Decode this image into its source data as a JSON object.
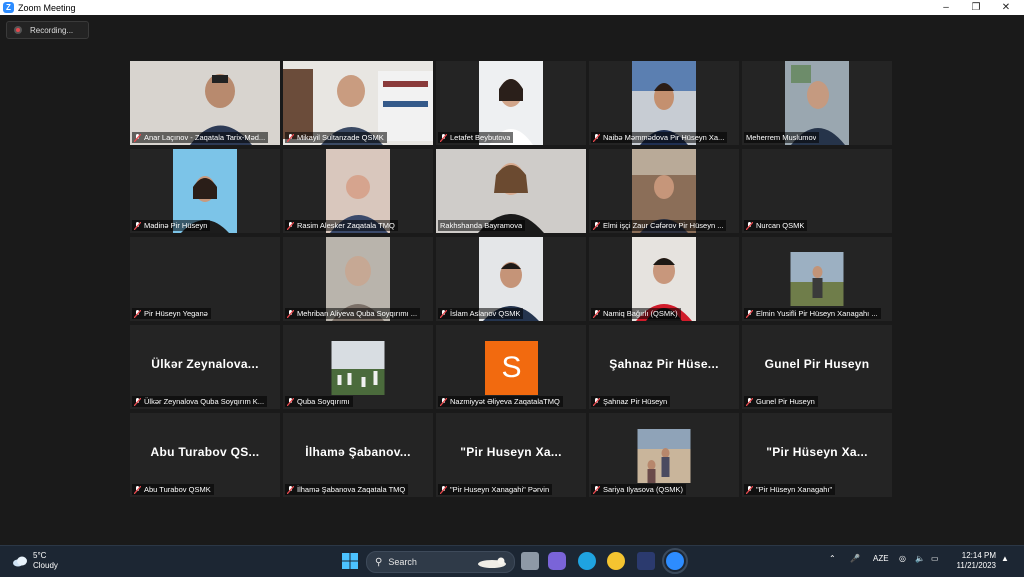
{
  "window": {
    "title": "Zoom Meeting",
    "logo_letter": "Z"
  },
  "recording": {
    "label": "Recording..."
  },
  "tiles": [
    {
      "name": "Anar Laçınov - Zaqatala Tarix-Məd...",
      "muted": true
    },
    {
      "name": "Mikayil Sultanzade QSMK",
      "muted": true
    },
    {
      "name": "Letafet Beybutova",
      "muted": true
    },
    {
      "name": "Naibə Məmmədova Pir Hüseyn Xa...",
      "muted": true
    },
    {
      "name": "Meherrem Muslumov",
      "muted": false
    },
    {
      "name": "Madinə Pir Hüseyn",
      "muted": true
    },
    {
      "name": "Rasim Alesker Zaqatala TMQ",
      "muted": true
    },
    {
      "name": "Rakhshanda Bayramova",
      "muted": false,
      "active": true
    },
    {
      "name": "Elmi işçi Zaur Cəfərov Pir Hüseyn ...",
      "muted": true
    },
    {
      "name": "Nurcan QSMK",
      "muted": true
    },
    {
      "name": "Pir Hüseyn Yeganə",
      "muted": true
    },
    {
      "name": "Mehriban Aliyeva Quba Soyqırımı ...",
      "muted": true
    },
    {
      "name": "İslam Aslanov QSMK",
      "muted": true
    },
    {
      "name": "Namiq Bağırlı (QSMK)",
      "muted": true
    },
    {
      "name": "Elmin Yusifli Pir Hüseyn Xanagahı ...",
      "muted": true
    },
    {
      "name": "Ülkər Zeynalova Quba Soyqırım K...",
      "muted": true,
      "display": "Ülkər Zeynalova..."
    },
    {
      "name": "Quba Soyqırımı",
      "muted": true
    },
    {
      "name": "Nazmiyyət Əliyeva ZaqatalaTMQ",
      "muted": true,
      "avatar_letter": "S"
    },
    {
      "name": "Şahnaz Pir Hüseyn",
      "muted": true,
      "display": "Şahnaz Pir Hüse..."
    },
    {
      "name": "Gunel Pir Huseyn",
      "muted": true,
      "display": "Gunel Pir Huseyn"
    },
    {
      "name": "Abu Turabov QSMK",
      "muted": true,
      "display": "Abu Turabov QS..."
    },
    {
      "name": "İlhamə Şabanova Zaqatala TMQ",
      "muted": true,
      "display": "İlhamə Şabanov..."
    },
    {
      "name": "\"Pir Huseyn Xanagahi\" Pərvin",
      "muted": true,
      "display": "\"Pir Huseyn Xa..."
    },
    {
      "name": "Sariya Ilyasova (QSMK)",
      "muted": true
    },
    {
      "name": "\"Pir Hüseyn Xanagahı\"",
      "muted": true,
      "display": "\"Pir Hüseyn Xa..."
    }
  ],
  "taskbar": {
    "weather_temp": "5°C",
    "weather_desc": "Cloudy",
    "search_placeholder": "Search",
    "language": "AZE",
    "time": "12:14 PM",
    "date": "11/21/2023"
  },
  "colors": {
    "accent": "#2d8cff",
    "active_speaker": "#b6d232",
    "muted_icon": "#e5484d",
    "avatar_orange": "#f26a0f"
  }
}
